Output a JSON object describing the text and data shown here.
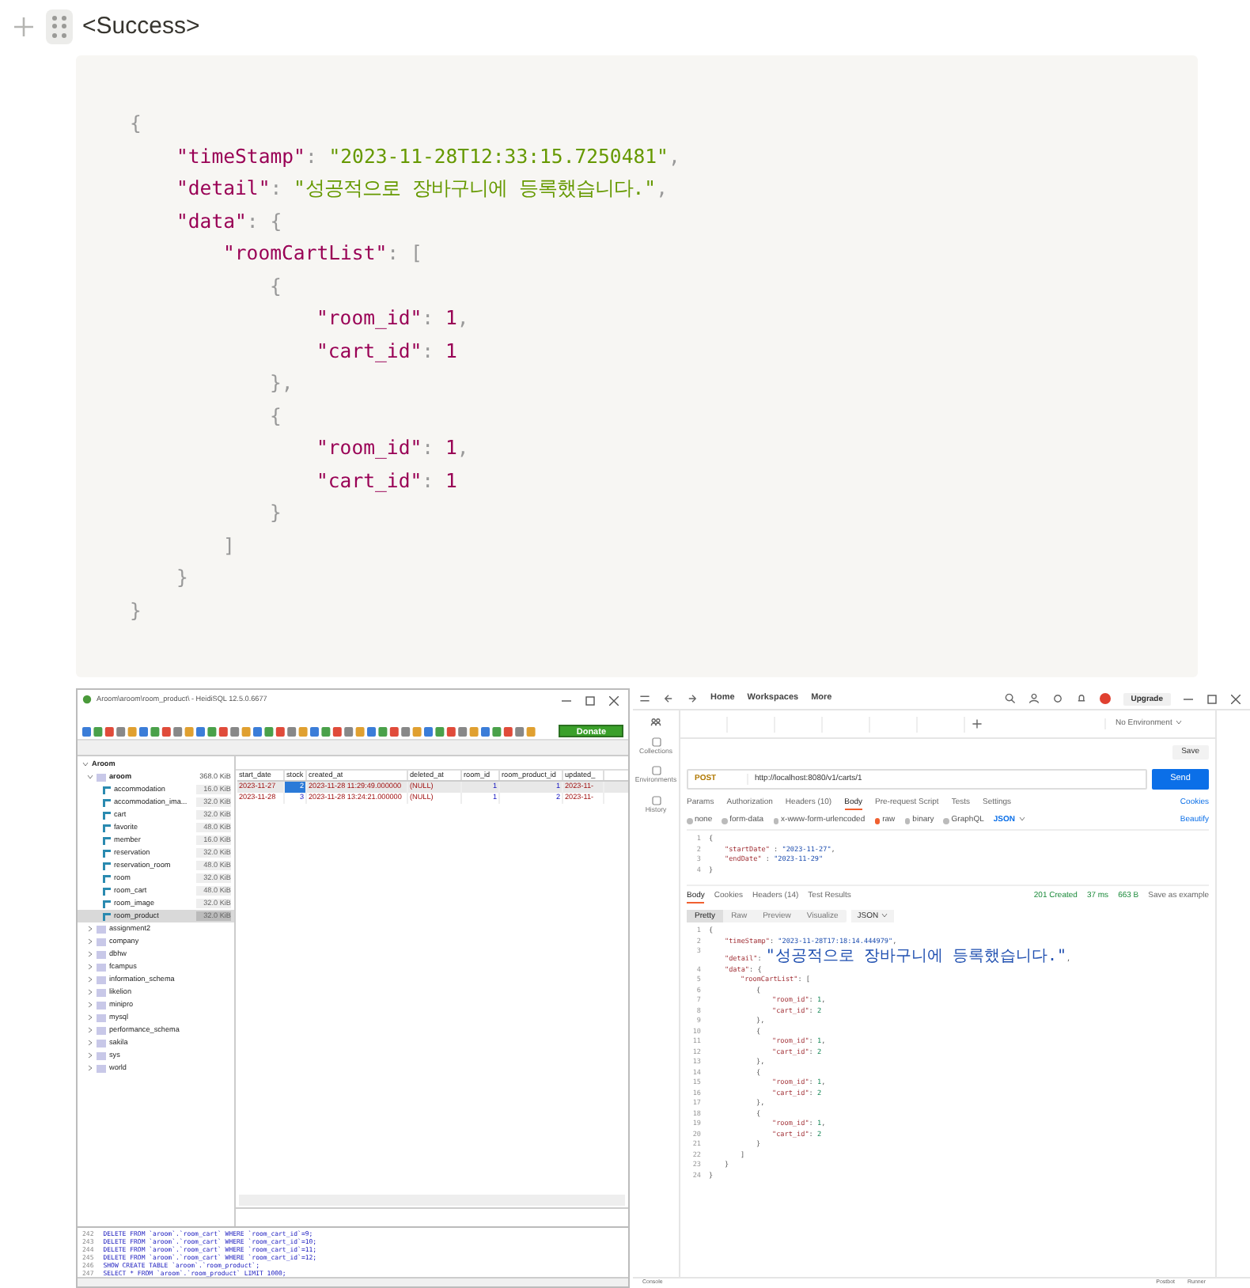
{
  "heading": "<Success>",
  "code_block": {
    "lines": [
      [
        {
          "kind": "punct",
          "text": "{"
        }
      ],
      [
        {
          "kind": "key",
          "text": "\"timeStamp\""
        },
        {
          "kind": "punct",
          "text": ": "
        },
        {
          "kind": "string",
          "text": "\"2023-11-28T12:33:15.7250481\""
        },
        {
          "kind": "punct",
          "text": ","
        }
      ],
      [
        {
          "kind": "key",
          "text": "\"detail\""
        },
        {
          "kind": "punct",
          "text": ": "
        },
        {
          "kind": "string",
          "text": "\"성공적으로 장바구니에 등록했습니다.\""
        },
        {
          "kind": "punct",
          "text": ","
        }
      ],
      [
        {
          "kind": "key",
          "text": "\"data\""
        },
        {
          "kind": "punct",
          "text": ": {"
        }
      ],
      [
        {
          "kind": "key",
          "text": "\"roomCartList\""
        },
        {
          "kind": "punct",
          "text": ": ["
        }
      ],
      [
        {
          "kind": "punct",
          "text": "{"
        }
      ],
      [
        {
          "kind": "key",
          "text": "\"room_id\""
        },
        {
          "kind": "punct",
          "text": ": "
        },
        {
          "kind": "number",
          "text": "1"
        },
        {
          "kind": "punct",
          "text": ","
        }
      ],
      [
        {
          "kind": "key",
          "text": "\"cart_id\""
        },
        {
          "kind": "punct",
          "text": ": "
        },
        {
          "kind": "number",
          "text": "1"
        }
      ],
      [
        {
          "kind": "punct",
          "text": "},"
        }
      ],
      [
        {
          "kind": "punct",
          "text": "{"
        }
      ],
      [
        {
          "kind": "key",
          "text": "\"room_id\""
        },
        {
          "kind": "punct",
          "text": ": "
        },
        {
          "kind": "number",
          "text": "1"
        },
        {
          "kind": "punct",
          "text": ","
        }
      ],
      [
        {
          "kind": "key",
          "text": "\"cart_id\""
        },
        {
          "kind": "punct",
          "text": ": "
        },
        {
          "kind": "number",
          "text": "1"
        }
      ],
      [
        {
          "kind": "punct",
          "text": "}"
        }
      ],
      [
        {
          "kind": "punct",
          "text": "]"
        }
      ],
      [
        {
          "kind": "punct",
          "text": "}"
        }
      ],
      [
        {
          "kind": "punct",
          "text": "}"
        }
      ]
    ]
  },
  "screenshot": {
    "heidisql": {
      "title": "Aroom\\aroom\\room_product\\ - HeidiSQL 12.5.0.6677",
      "donate": "Donate",
      "tree": {
        "root": "Aroom",
        "databases": [
          {
            "name": "aroom",
            "size": "368.0 KiB",
            "expanded": true,
            "children": [
              {
                "name": "accommodation",
                "size": "16.0 KiB",
                "selected": false
              },
              {
                "name": "accommodation_ima...",
                "size": "32.0 KiB",
                "selected": false
              },
              {
                "name": "cart",
                "size": "32.0 KiB",
                "selected": false
              },
              {
                "name": "favorite",
                "size": "48.0 KiB",
                "selected": false
              },
              {
                "name": "member",
                "size": "16.0 KiB",
                "selected": false
              },
              {
                "name": "reservation",
                "size": "32.0 KiB",
                "selected": false
              },
              {
                "name": "reservation_room",
                "size": "48.0 KiB",
                "selected": false
              },
              {
                "name": "room",
                "size": "32.0 KiB",
                "selected": false
              },
              {
                "name": "room_cart",
                "size": "48.0 KiB",
                "selected": false
              },
              {
                "name": "room_image",
                "size": "32.0 KiB",
                "selected": false
              },
              {
                "name": "room_product",
                "size": "32.0 KiB",
                "selected": true
              }
            ]
          },
          {
            "name": "assignment2",
            "expanded": false
          },
          {
            "name": "company",
            "expanded": false
          },
          {
            "name": "dbhw",
            "expanded": false
          },
          {
            "name": "fcampus",
            "expanded": false
          },
          {
            "name": "information_schema",
            "expanded": false
          },
          {
            "name": "likelion",
            "expanded": false
          },
          {
            "name": "minipro",
            "expanded": false
          },
          {
            "name": "mysql",
            "expanded": false
          },
          {
            "name": "performance_schema",
            "expanded": false
          },
          {
            "name": "sakila",
            "expanded": false
          },
          {
            "name": "sys",
            "expanded": false
          },
          {
            "name": "world",
            "expanded": false
          }
        ]
      },
      "grid": {
        "columns": [
          "start_date",
          "stock",
          "created_at",
          "deleted_at",
          "room_id",
          "room_product_id",
          "updated_"
        ],
        "rows": [
          {
            "selected": true,
            "cells": [
              "2023-11-27",
              "2",
              "2023-11-28 11:29:49.000000",
              "(NULL)",
              "1",
              "1",
              "2023-11-"
            ]
          },
          {
            "selected": false,
            "cells": [
              "2023-11-28",
              "3",
              "2023-11-28 13:24:21.000000",
              "(NULL)",
              "1",
              "2",
              "2023-11-"
            ]
          }
        ]
      },
      "sql_log": [
        {
          "number": "242",
          "text": "DELETE FROM `aroom`.`room_cart` WHERE `room_cart_id`=9;"
        },
        {
          "number": "243",
          "text": "DELETE FROM `aroom`.`room_cart` WHERE `room_cart_id`=10;"
        },
        {
          "number": "244",
          "text": "DELETE FROM `aroom`.`room_cart` WHERE `room_cart_id`=11;"
        },
        {
          "number": "245",
          "text": "DELETE FROM `aroom`.`room_cart` WHERE `room_cart_id`=12;"
        },
        {
          "number": "246",
          "text": "SHOW CREATE TABLE `aroom`.`room_product`;"
        },
        {
          "number": "247",
          "text": "SELECT * FROM `aroom`.`room_product` LIMIT 1000;"
        }
      ]
    },
    "postman": {
      "nav": [
        "Home",
        "Workspaces",
        "More"
      ],
      "upgrade": "Upgrade",
      "environment": "No Environment",
      "sidebar": [
        "Collections",
        "Environments",
        "History"
      ],
      "save": "Save",
      "method": "POST",
      "url": "http://localhost:8080/v1/carts/1",
      "send": "Send",
      "request_tabs": [
        {
          "label": "Params",
          "selected": false
        },
        {
          "label": "Authorization",
          "selected": false
        },
        {
          "label": "Headers (10)",
          "selected": false
        },
        {
          "label": "Body",
          "selected": true
        },
        {
          "label": "Pre-request Script",
          "selected": false
        },
        {
          "label": "Tests",
          "selected": false
        },
        {
          "label": "Settings",
          "selected": false
        }
      ],
      "cookies": "Cookies",
      "body_types": [
        {
          "label": "none",
          "selected": false
        },
        {
          "label": "form-data",
          "selected": false
        },
        {
          "label": "x-www-form-urlencoded",
          "selected": false
        },
        {
          "label": "raw",
          "selected": true
        },
        {
          "label": "binary",
          "selected": false
        },
        {
          "label": "GraphQL",
          "selected": false
        }
      ],
      "format": "JSON",
      "beautify": "Beautify",
      "request_body": [
        {
          "number": "1",
          "tokens": [
            {
              "kind": "punct",
              "text": "{"
            }
          ]
        },
        {
          "number": "2",
          "tokens": [
            {
              "kind": "key",
              "text": "\"startDate\""
            },
            {
              "kind": "punct",
              "text": " : "
            },
            {
              "kind": "string",
              "text": "\"2023-11-27\""
            },
            {
              "kind": "punct",
              "text": ","
            }
          ]
        },
        {
          "number": "3",
          "tokens": [
            {
              "kind": "key",
              "text": "\"endDate\""
            },
            {
              "kind": "punct",
              "text": " : "
            },
            {
              "kind": "string",
              "text": "\"2023-11-29\""
            }
          ]
        },
        {
          "number": "4",
          "tokens": [
            {
              "kind": "punct",
              "text": "}"
            }
          ]
        }
      ],
      "response_tabs": [
        {
          "label": "Body",
          "selected": true
        },
        {
          "label": "Cookies",
          "selected": false
        },
        {
          "label": "Headers (14)",
          "selected": false
        },
        {
          "label": "Test Results",
          "selected": false
        }
      ],
      "status": "201 Created",
      "time": "37 ms",
      "size": "663 B",
      "save_example": "Save as example",
      "view_tabs": [
        {
          "label": "Pretty",
          "selected": true
        },
        {
          "label": "Raw",
          "selected": false
        },
        {
          "label": "Preview",
          "selected": false
        },
        {
          "label": "Visualize",
          "selected": false
        }
      ],
      "response_format": "JSON",
      "response_body": [
        {
          "number": "1",
          "tokens": [
            {
              "kind": "punct",
              "text": "{"
            }
          ]
        },
        {
          "number": "2",
          "tokens": [
            {
              "kind": "key",
              "text": "\"timeStamp\""
            },
            {
              "kind": "punct",
              "text": ": "
            },
            {
              "kind": "string",
              "text": "\"2023-11-28T17:18:14.444979\""
            },
            {
              "kind": "punct",
              "text": ","
            }
          ]
        },
        {
          "number": "3",
          "tokens": [
            {
              "kind": "key",
              "text": "\"detail\""
            },
            {
              "kind": "punct",
              "text": ": "
            },
            {
              "kind": "string",
              "text": "\"성공적으로 장바구니에 등록했습니다.\""
            },
            {
              "kind": "punct",
              "text": ","
            }
          ]
        },
        {
          "number": "4",
          "tokens": [
            {
              "kind": "key",
              "text": "\"data\""
            },
            {
              "kind": "punct",
              "text": ": {"
            }
          ]
        },
        {
          "number": "5",
          "tokens": [
            {
              "kind": "key",
              "text": "\"roomCartList\""
            },
            {
              "kind": "punct",
              "text": ": ["
            }
          ]
        },
        {
          "number": "6",
          "tokens": [
            {
              "kind": "punct",
              "text": "{"
            }
          ]
        },
        {
          "number": "7",
          "tokens": [
            {
              "kind": "key",
              "text": "\"room_id\""
            },
            {
              "kind": "punct",
              "text": ": "
            },
            {
              "kind": "number",
              "text": "1"
            },
            {
              "kind": "punct",
              "text": ","
            }
          ]
        },
        {
          "number": "8",
          "tokens": [
            {
              "kind": "key",
              "text": "\"cart_id\""
            },
            {
              "kind": "punct",
              "text": ": "
            },
            {
              "kind": "number",
              "text": "2"
            }
          ]
        },
        {
          "number": "9",
          "tokens": [
            {
              "kind": "punct",
              "text": "},"
            }
          ]
        },
        {
          "number": "10",
          "tokens": [
            {
              "kind": "punct",
              "text": "{"
            }
          ]
        },
        {
          "number": "11",
          "tokens": [
            {
              "kind": "key",
              "text": "\"room_id\""
            },
            {
              "kind": "punct",
              "text": ": "
            },
            {
              "kind": "number",
              "text": "1"
            },
            {
              "kind": "punct",
              "text": ","
            }
          ]
        },
        {
          "number": "12",
          "tokens": [
            {
              "kind": "key",
              "text": "\"cart_id\""
            },
            {
              "kind": "punct",
              "text": ": "
            },
            {
              "kind": "number",
              "text": "2"
            }
          ]
        },
        {
          "number": "13",
          "tokens": [
            {
              "kind": "punct",
              "text": "},"
            }
          ]
        },
        {
          "number": "14",
          "tokens": [
            {
              "kind": "punct",
              "text": "{"
            }
          ]
        },
        {
          "number": "15",
          "tokens": [
            {
              "kind": "key",
              "text": "\"room_id\""
            },
            {
              "kind": "punct",
              "text": ": "
            },
            {
              "kind": "number",
              "text": "1"
            },
            {
              "kind": "punct",
              "text": ","
            }
          ]
        },
        {
          "number": "16",
          "tokens": [
            {
              "kind": "key",
              "text": "\"cart_id\""
            },
            {
              "kind": "punct",
              "text": ": "
            },
            {
              "kind": "number",
              "text": "2"
            }
          ]
        },
        {
          "number": "17",
          "tokens": [
            {
              "kind": "punct",
              "text": "},"
            }
          ]
        },
        {
          "number": "18",
          "tokens": [
            {
              "kind": "punct",
              "text": "{"
            }
          ]
        },
        {
          "number": "19",
          "tokens": [
            {
              "kind": "key",
              "text": "\"room_id\""
            },
            {
              "kind": "punct",
              "text": ": "
            },
            {
              "kind": "number",
              "text": "1"
            },
            {
              "kind": "punct",
              "text": ","
            }
          ]
        },
        {
          "number": "20",
          "tokens": [
            {
              "kind": "key",
              "text": "\"cart_id\""
            },
            {
              "kind": "punct",
              "text": ": "
            },
            {
              "kind": "number",
              "text": "2"
            }
          ]
        },
        {
          "number": "21",
          "tokens": [
            {
              "kind": "punct",
              "text": "}"
            }
          ]
        },
        {
          "number": "22",
          "tokens": [
            {
              "kind": "punct",
              "text": "]"
            }
          ]
        },
        {
          "number": "23",
          "tokens": [
            {
              "kind": "punct",
              "text": "}"
            }
          ]
        },
        {
          "number": "24",
          "tokens": [
            {
              "kind": "punct",
              "text": "}"
            }
          ]
        }
      ],
      "footer": [
        "Console",
        "Postbot",
        "Runner"
      ]
    }
  }
}
